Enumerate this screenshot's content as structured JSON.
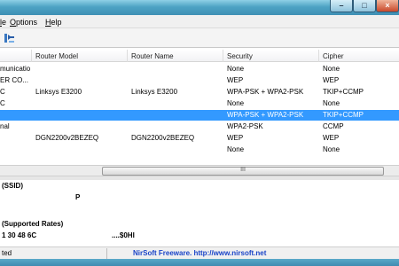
{
  "menu": {
    "items": [
      "le",
      "Options",
      "Help"
    ]
  },
  "list": {
    "columns": [
      "",
      "Router Model",
      "Router Name",
      "Security",
      "Cipher"
    ],
    "rows": [
      {
        "c0": "municatio...",
        "c1": "",
        "c2": "",
        "c3": "None",
        "c4": "None",
        "selected": false
      },
      {
        "c0": "ER CO...",
        "c1": "",
        "c2": "",
        "c3": "WEP",
        "c4": "WEP",
        "selected": false
      },
      {
        "c0": "C",
        "c1": "Linksys E3200",
        "c2": "Linksys E3200",
        "c3": "WPA-PSK + WPA2-PSK",
        "c4": "TKIP+CCMP",
        "selected": false
      },
      {
        "c0": "C",
        "c1": "",
        "c2": "",
        "c3": "None",
        "c4": "None",
        "selected": false
      },
      {
        "c0": "",
        "c1": "",
        "c2": "",
        "c3": "WPA-PSK + WPA2-PSK",
        "c4": "TKIP+CCMP",
        "selected": true
      },
      {
        "c0": "nal",
        "c1": "",
        "c2": "",
        "c3": "WPA2-PSK",
        "c4": "CCMP",
        "selected": false
      },
      {
        "c0": "",
        "c1": "DGN2200v2BEZEQ",
        "c2": "DGN2200v2BEZEQ",
        "c3": "WEP",
        "c4": "WEP",
        "selected": false
      },
      {
        "c0": "",
        "c1": "",
        "c2": "",
        "c3": "None",
        "c4": "None",
        "selected": false
      }
    ]
  },
  "scrollbar": {
    "grip": "III"
  },
  "detail": {
    "line1": "(SSID)",
    "line2": "P",
    "line3": "(Supported Rates)",
    "line4": "1 30 48 6C",
    "line5": "....$0HI"
  },
  "status": {
    "left": "ted",
    "link": "NirSoft Freeware.  http://www.nirsoft.net"
  },
  "colors": {
    "selection": "#3399ff",
    "link": "#1a44c8",
    "titlebar": "#4ea3c4"
  },
  "icons": {
    "toolbar": "refresh-icon"
  }
}
